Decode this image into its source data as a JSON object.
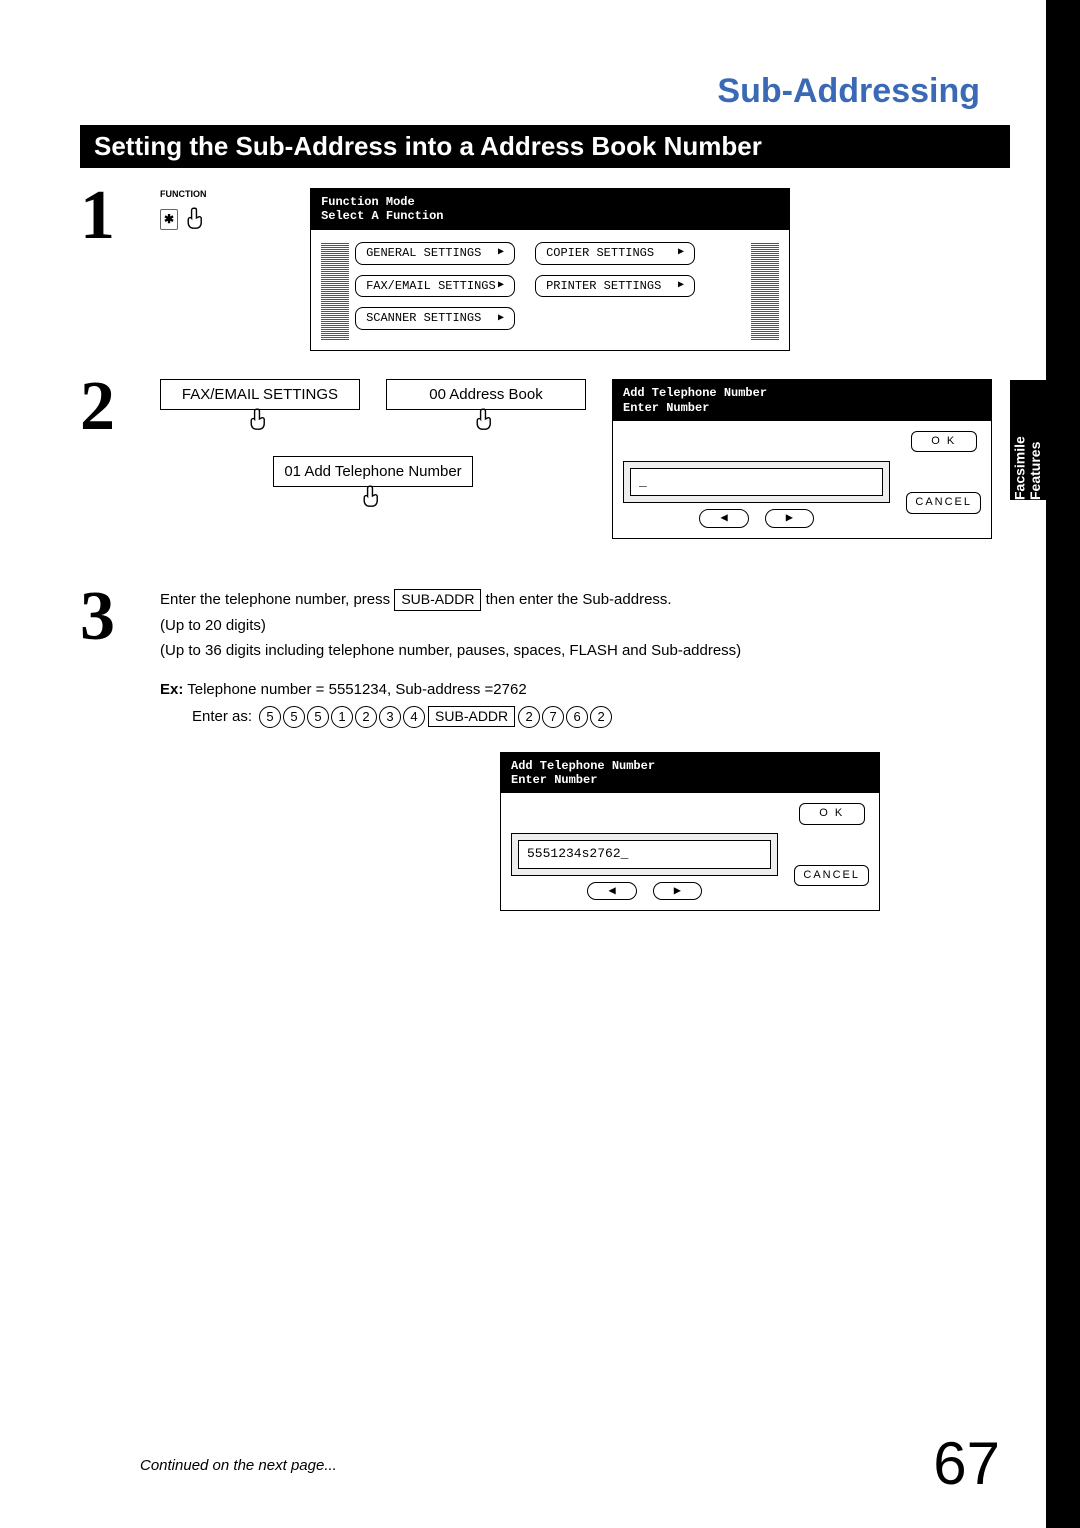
{
  "chapter_title": "Sub-Addressing",
  "section_title": "Setting the Sub-Address into a Address Book Number",
  "side_tab": "Facsimile\nFeatures",
  "page_number": "67",
  "continued_text": "Continued on the next page...",
  "step1": {
    "func_label": "FUNCTION",
    "asterisk": "✱",
    "lcd": {
      "title1": "Function Mode",
      "title2": "Select A Function",
      "btn_general": "GENERAL SETTINGS",
      "btn_copier": "COPIER SETTINGS",
      "btn_faxemail": "FAX/EMAIL SETTINGS",
      "btn_printer": "PRINTER SETTINGS",
      "btn_scanner": "SCANNER SETTINGS"
    }
  },
  "step2": {
    "btn_faxemail": "FAX/EMAIL SETTINGS",
    "btn_addressbook": "00 Address Book",
    "btn_addtel": "01 Add Telephone Number",
    "lcd": {
      "title1": "Add Telephone Number",
      "title2": "Enter Number",
      "ok": "O K",
      "cancel": "CANCEL",
      "cursor": "_"
    }
  },
  "step3": {
    "line1a": "Enter the telephone number, press ",
    "line1b": " then enter the Sub-address.",
    "sub_addr_key": "SUB-ADDR",
    "line2": "(Up to 20 digits)",
    "line3": "(Up to 36 digits including telephone number, pauses, spaces, FLASH and Sub-address)",
    "ex_label": "Ex:",
    "ex_text": " Telephone number = 5551234, Sub-address =2762",
    "enter_as_label": "Enter as:",
    "keys_before": [
      "5",
      "5",
      "5",
      "1",
      "2",
      "3",
      "4"
    ],
    "keys_after": [
      "2",
      "7",
      "6",
      "2"
    ],
    "lcd": {
      "title1": "Add Telephone Number",
      "title2": "Enter Number",
      "value": "5551234s2762_",
      "ok": "O K",
      "cancel": "CANCEL"
    }
  }
}
